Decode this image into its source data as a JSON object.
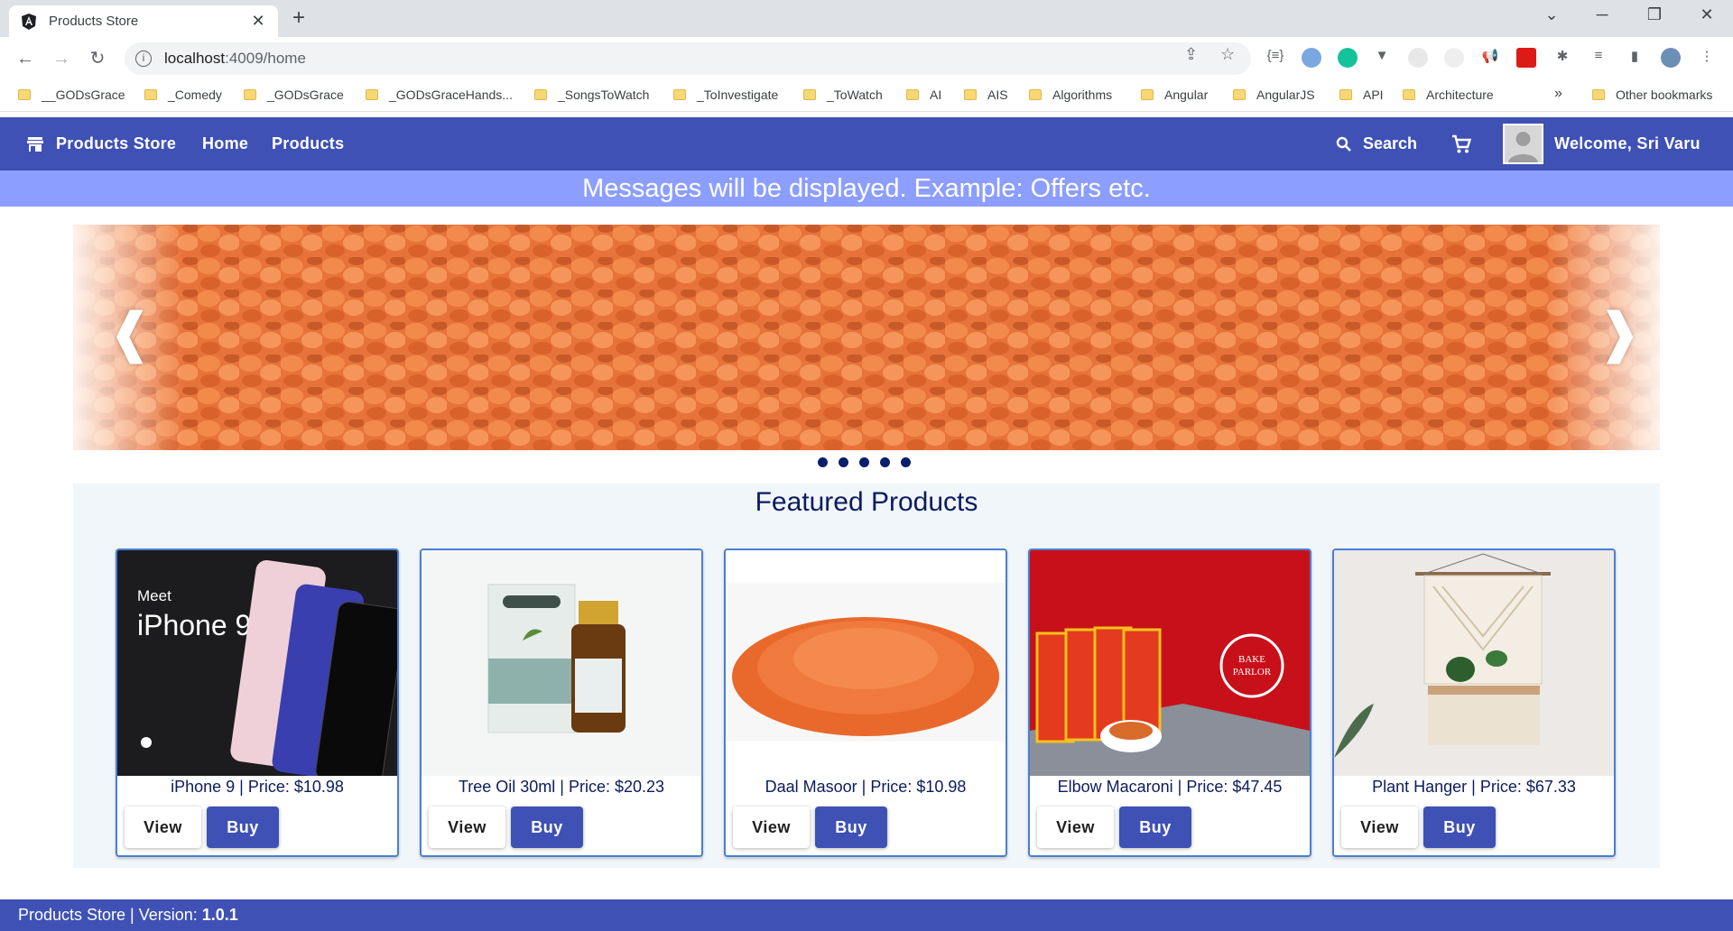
{
  "browser": {
    "tab_title": "Products Store",
    "url_host": "localhost",
    "url_path": ":4009/home",
    "bookmarks": [
      "__GODsGrace",
      "_Comedy",
      "_GODsGrace",
      "_GODsGraceHands...",
      "_SongsToWatch",
      "_ToInvestigate",
      "_ToWatch",
      "AI",
      "AIS",
      "Algorithms",
      "Angular",
      "AngularJS",
      "API",
      "Architecture"
    ],
    "bookmarks_more": "»",
    "other_bookmarks": "Other bookmarks"
  },
  "app": {
    "brand": "Products Store",
    "nav": [
      "Home",
      "Products"
    ],
    "search_label": "Search",
    "welcome": "Welcome, Sri Varu",
    "message": "Messages will be displayed. Example: Offers etc.",
    "carousel": {
      "slides": 5,
      "prev": "❰",
      "next": "❱"
    },
    "featured_title": "Featured Products",
    "products": [
      {
        "caption": "iPhone 9 | Price: $10.98",
        "image_text": "Meet iPhone 9"
      },
      {
        "caption": "Tree Oil 30ml | Price: $20.23",
        "image_text": "HEMANI TEA TREE OIL"
      },
      {
        "caption": "Daal Masoor | Price: $10.98",
        "image_text": ""
      },
      {
        "caption": "Elbow Macaroni | Price: $47.45",
        "image_text": "BAKE PARLOR"
      },
      {
        "caption": "Plant Hanger | Price: $67.33",
        "image_text": ""
      }
    ],
    "view_label": "View",
    "buy_label": "Buy",
    "footer_prefix": "Products Store | Version: ",
    "footer_version": "1.0.1"
  },
  "colors": {
    "primary": "#3f51b5",
    "message_bar": "#8c9eff",
    "featured_bg": "#f0f6fa",
    "title_text": "#0d1b5e"
  }
}
